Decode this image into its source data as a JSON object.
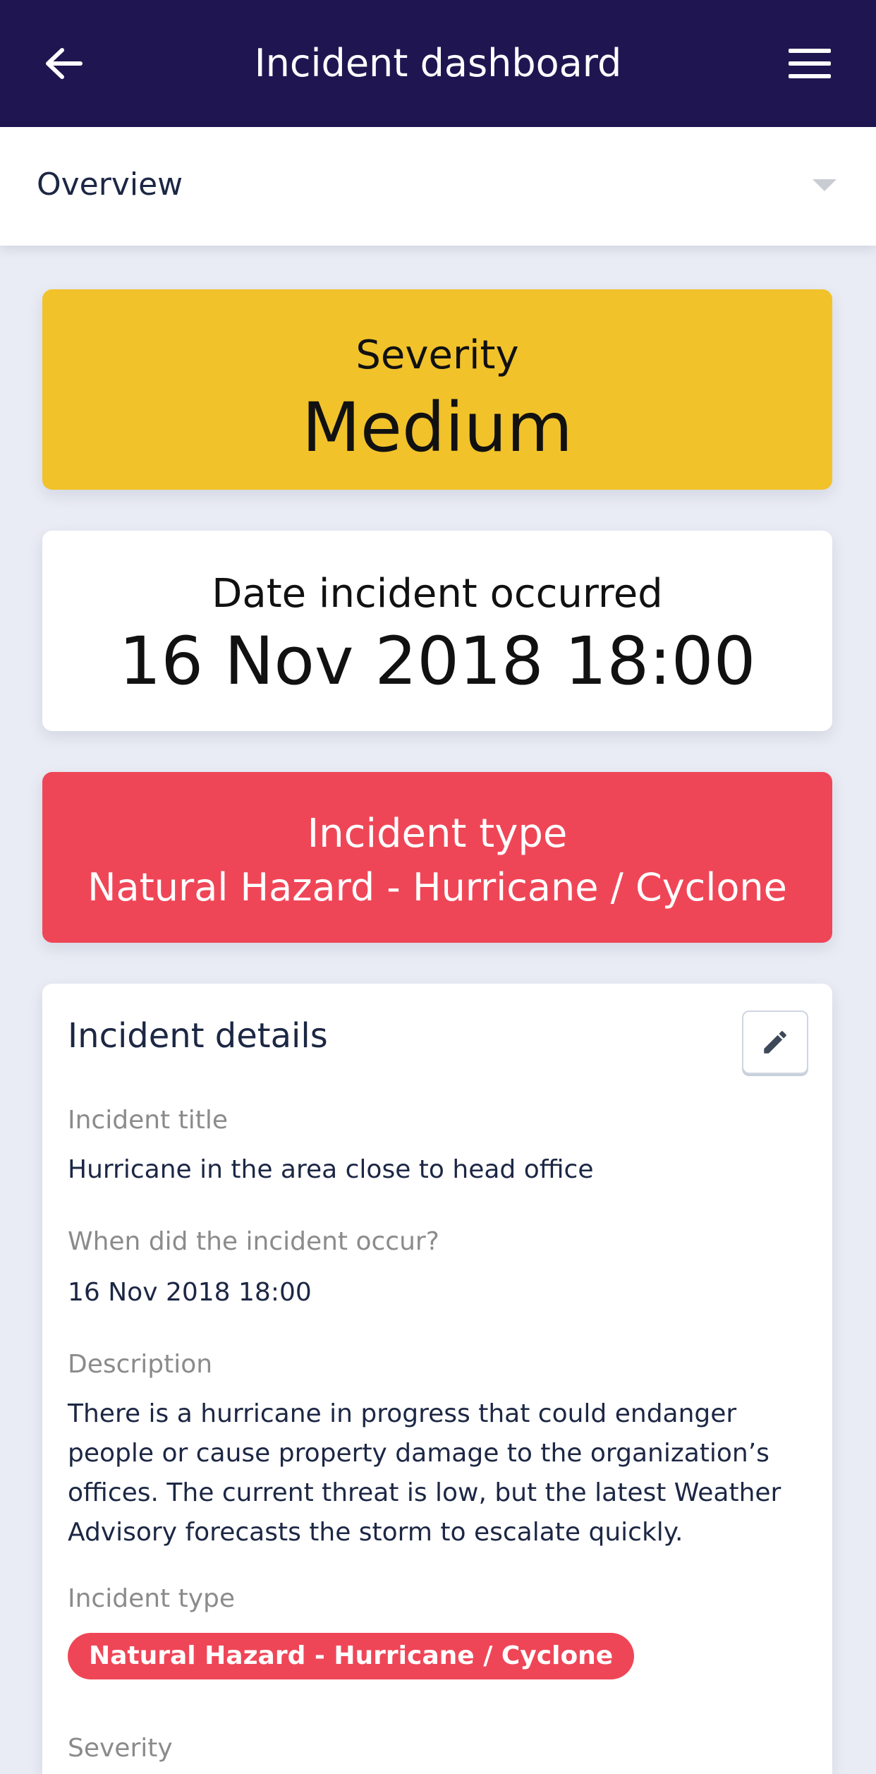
{
  "appbar": {
    "title": "Incident dashboard",
    "back_icon": "arrow-left-icon",
    "menu_icon": "hamburger-menu-icon",
    "background": "#1f1651"
  },
  "tabs": {
    "selected": "Overview",
    "caret_icon": "caret-down-icon"
  },
  "severity_card": {
    "label": "Severity",
    "value": "Medium",
    "color": "#f1c22a"
  },
  "date_card": {
    "label": "Date incident occurred",
    "value": "16 Nov 2018 18:00"
  },
  "type_card": {
    "label": "Incident type",
    "value": "Natural Hazard - Hurricane / Cyclone",
    "color": "#ef4657"
  },
  "details": {
    "heading": "Incident details",
    "edit_icon": "pencil-icon",
    "title_label": "Incident title",
    "title_value": "Hurricane in the area close to head office",
    "when_label": "When did the incident occur?",
    "when_value": "16 Nov 2018 18:00",
    "description_label": "Description",
    "description_value": "There is a hurricane in progress that could endanger people or cause property damage to the organization’s offices. The current threat is low, but the latest Weather Advisory forecasts the storm to escalate quickly.",
    "type_label": "Incident type",
    "type_value": "Natural Hazard - Hurricane / Cyclone",
    "severity_label": "Severity"
  }
}
